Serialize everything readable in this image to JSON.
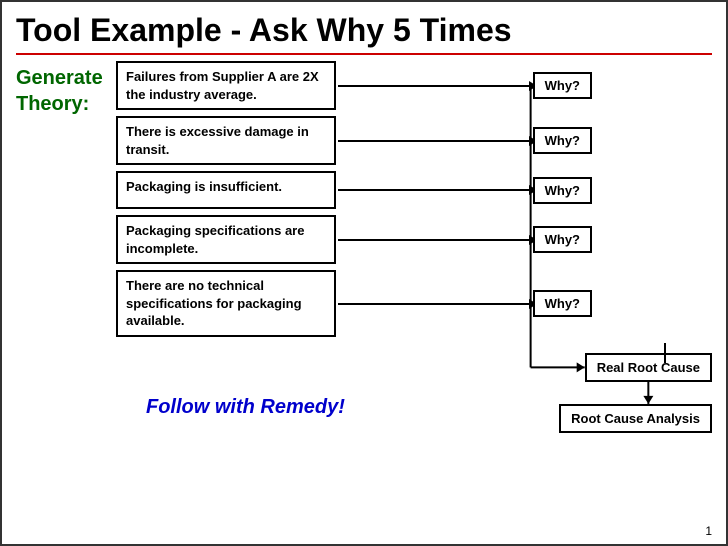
{
  "title": "Tool Example - Ask Why 5 Times",
  "left_label_line1": "Generate",
  "left_label_line2": "Theory:",
  "rows": [
    {
      "id": 1,
      "cause_text": "Failures from Supplier A are 2X the industry average.",
      "why_label": "Why?"
    },
    {
      "id": 2,
      "cause_text": "There is excessive damage in transit.",
      "why_label": "Why?"
    },
    {
      "id": 3,
      "cause_text": "Packaging is insufficient.",
      "why_label": "Why?"
    },
    {
      "id": 4,
      "cause_text": "Packaging specifications are incomplete.",
      "why_label": "Why?"
    },
    {
      "id": 5,
      "cause_text": "There are no technical specifications for packaging available.",
      "why_label": "Why?"
    }
  ],
  "follow_text": "Follow with Remedy!",
  "real_root_cause_label": "Real Root Cause",
  "root_cause_analysis_label": "Root Cause Analysis",
  "page_number": "1"
}
